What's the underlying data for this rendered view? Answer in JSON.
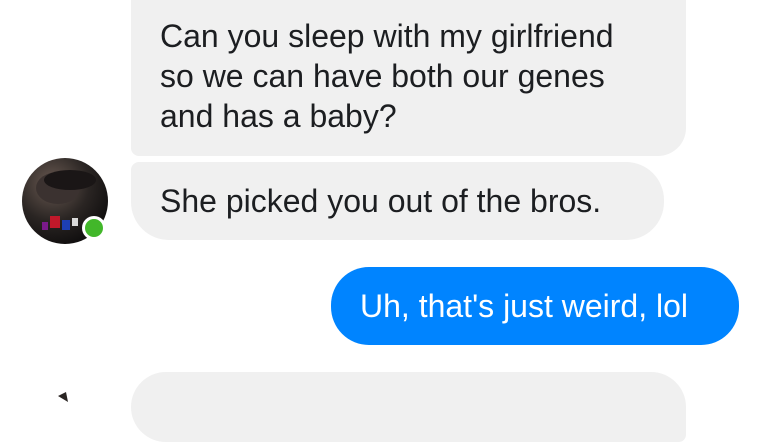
{
  "messages": [
    {
      "direction": "incoming",
      "text": "Can you sleep with my girlfriend\nso we can have both our genes\nand has a baby?"
    },
    {
      "direction": "incoming",
      "text": "She picked you out of the bros."
    },
    {
      "direction": "outgoing",
      "text": "Uh, that's just weird, lol"
    },
    {
      "direction": "incoming",
      "text": ""
    }
  ],
  "contact": {
    "online": true
  },
  "colors": {
    "incoming_bubble": "#f0f0f0",
    "outgoing_bubble": "#0084ff",
    "online_dot": "#42b72a"
  }
}
